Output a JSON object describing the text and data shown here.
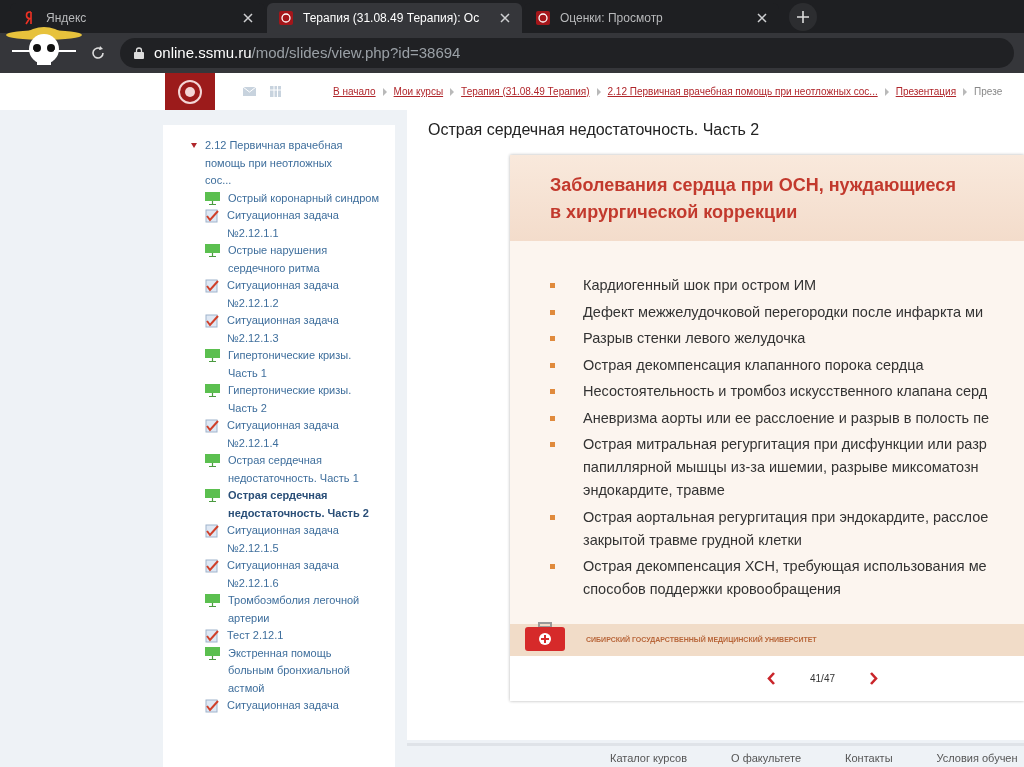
{
  "browser": {
    "tabs": [
      {
        "kind": "yandex",
        "title": "Яндекс",
        "selected": false
      },
      {
        "kind": "site",
        "title": "Терапия (31.08.49 Терапия): Ос",
        "selected": true
      },
      {
        "kind": "site",
        "title": "Оценки: Просмотр",
        "selected": false
      }
    ],
    "address": {
      "host": "online.ssmu.ru",
      "path": "/mod/slides/view.php?id=38694"
    }
  },
  "breadcrumbs": [
    "В начало",
    "Мои курсы",
    "Терапия (31.08.49 Терапия)",
    "2.12 Первичная врачебная помощь при неотложных сос...",
    "Презентация",
    "Презе"
  ],
  "sidebar": {
    "section": {
      "title": "2.12 Первичная врачебная помощь при неотложных сос...",
      "expanded": true
    },
    "items": [
      {
        "kind": "slides",
        "label": "Острый коронарный синдром",
        "selected": false
      },
      {
        "kind": "task",
        "label": "Ситуационная задача №2.12.1.1",
        "selected": false
      },
      {
        "kind": "slides",
        "label": "Острые нарушения сердечного ритма",
        "selected": false
      },
      {
        "kind": "task",
        "label": "Ситуационная задача №2.12.1.2",
        "selected": false
      },
      {
        "kind": "task",
        "label": "Ситуационная задача №2.12.1.3",
        "selected": false
      },
      {
        "kind": "slides",
        "label": "Гипертонические кризы. Часть 1",
        "selected": false
      },
      {
        "kind": "slides",
        "label": "Гипертонические кризы. Часть 2",
        "selected": false
      },
      {
        "kind": "task",
        "label": "Ситуационная задача №2.12.1.4",
        "selected": false
      },
      {
        "kind": "slides",
        "label": "Острая сердечная недостаточность. Часть 1",
        "selected": false
      },
      {
        "kind": "slides",
        "label": "Острая сердечная недостаточность. Часть 2",
        "selected": true
      },
      {
        "kind": "task",
        "label": "Ситуационная задача №2.12.1.5",
        "selected": false
      },
      {
        "kind": "task",
        "label": "Ситуационная задача №2.12.1.6",
        "selected": false
      },
      {
        "kind": "slides",
        "label": "Тромбоэмболия легочной артерии",
        "selected": false
      },
      {
        "kind": "task",
        "label": "Тест 2.12.1",
        "selected": false
      },
      {
        "kind": "slides",
        "label": "Экстренная помощь больным бронхиальной астмой",
        "selected": false
      },
      {
        "kind": "task",
        "label": "Ситуационная задача",
        "selected": false
      }
    ]
  },
  "page_title": "Острая сердечная недостаточность. Часть 2",
  "slide": {
    "title": "Заболевания сердца при ОСН, нуждающиеся\nв хирургической коррекции",
    "bullets": [
      "Кардиогенный шок при остром ИМ",
      "Дефект межжелудочковой перегородки после инфаркта ми",
      "Разрыв стенки левого желудочка",
      "Острая декомпенсация клапанного порока сердца",
      "Несостоятельность и тромбоз искусственного клапана серд",
      "Аневризма аорты или ее расслоение и разрыв в полость пе",
      "Острая митральная регургитация при дисфункции или разр\nпапиллярной мышцы из-за ишемии, разрыве миксоматозн\nэндокардите, травме",
      "Острая аортальная регургитация при эндокардите, расслое\nзакрытой травме грудной клетки",
      "Острая декомпенсация ХСН, требующая использования ме\nспособов поддержки кровообращения"
    ],
    "footer": "СИБИРСКИЙ ГОСУДАРСТВЕННЫЙ МЕДИЦИНСКИЙ УНИВЕРСИТЕТ",
    "counter": "41/47"
  },
  "footer_links": [
    "Каталог курсов",
    "О факультете",
    "Контакты",
    "Условия обучен"
  ]
}
